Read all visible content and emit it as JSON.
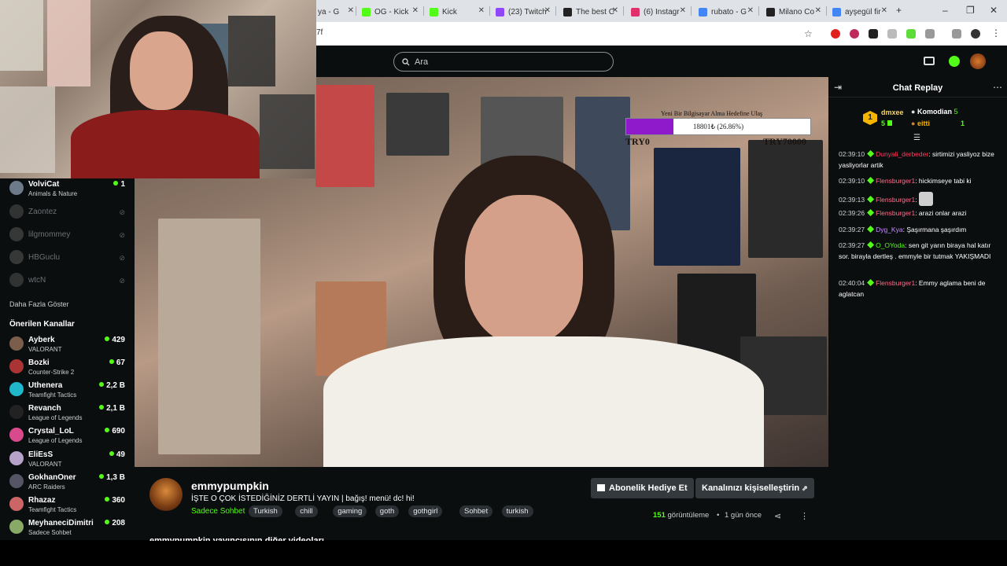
{
  "browser": {
    "tabs": [
      {
        "label": "ya - G",
        "color": "#4285f4"
      },
      {
        "label": "OG - Kick",
        "color": "#53fc18"
      },
      {
        "label": "Kick",
        "color": "#53fc18"
      },
      {
        "label": "(23) Twitch",
        "color": "#9146ff"
      },
      {
        "label": "The best C",
        "color": "#222222"
      },
      {
        "label": "(6) Instagr",
        "color": "#e1306c"
      },
      {
        "label": "rubato - G",
        "color": "#4285f4"
      },
      {
        "label": "Milano Co",
        "color": "#222222"
      },
      {
        "label": "ayşegül fir",
        "color": "#4285f4"
      }
    ],
    "address_fragment": "7f",
    "new_tab": "+"
  },
  "header": {
    "search_placeholder": "Ara"
  },
  "sidebar": {
    "followed": [
      {
        "name": "VolviCat",
        "category": "Animals & Nature",
        "viewers": "1",
        "live": true,
        "color": "#6c7a89"
      },
      {
        "name": "Zaontez",
        "live": false,
        "color": "#777"
      },
      {
        "name": "lilgmommey",
        "live": false,
        "color": "#888"
      },
      {
        "name": "HBGuclu",
        "live": false,
        "color": "#888"
      },
      {
        "name": "wtcN",
        "live": false,
        "color": "#777"
      }
    ],
    "show_more": "Daha Fazla Göster",
    "recommended_title": "Önerilen Kanallar",
    "recommended": [
      {
        "name": "Ayberk",
        "category": "VALORANT",
        "viewers": "429",
        "color": "#7a5d4a"
      },
      {
        "name": "Bozki",
        "category": "Counter-Strike 2",
        "viewers": "67",
        "color": "#a33"
      },
      {
        "name": "Uthenera",
        "category": "Teamfight Tactics",
        "viewers": "2,2 B",
        "color": "#1fb7c9"
      },
      {
        "name": "Revanch",
        "category": "League of Legends",
        "viewers": "2,1 B",
        "color": "#222"
      },
      {
        "name": "Crystal_LoL",
        "category": "League of Legends",
        "viewers": "690",
        "color": "#d94a8c"
      },
      {
        "name": "EliEsS",
        "category": "VALORANT",
        "viewers": "49",
        "color": "#b7a3c9"
      },
      {
        "name": "GokhanOner",
        "category": "ARC Raiders",
        "viewers": "1,3 B",
        "color": "#556"
      },
      {
        "name": "Rhazaz",
        "category": "Teamfight Tactics",
        "viewers": "360",
        "color": "#c66"
      },
      {
        "name": "MeyhaneciDimitri",
        "category": "Sadece Sohbet",
        "viewers": "208",
        "color": "#8a6"
      }
    ]
  },
  "video": {
    "goal_title": "Yeni Bir Bilgisayar Alma Hedefine Ulaş",
    "goal_text": "18801₺ (26.86%)",
    "goal_progress": 0.2686,
    "goal_min": "TRY0",
    "goal_max": "TRY70000"
  },
  "chat": {
    "title": "Chat Replay",
    "gifters": {
      "rank": "1",
      "first": {
        "name": "dmxee",
        "count": "5"
      },
      "second": {
        "name": "Komodian",
        "count": "5"
      },
      "third": {
        "name": "eitti",
        "count": "1"
      }
    },
    "messages": [
      {
        "time": "02:39:10",
        "user": "Dunyali_derbeder",
        "color": "#ff3b5c",
        "text": "sirtimizi yasliyoz bize yasliyorlar artik"
      },
      {
        "time": "02:39:10",
        "user": "Flensburger1",
        "color": "#ff6b8b",
        "text": "hickimseye tabi ki"
      },
      {
        "time": "02:39:13",
        "user": "Flensburger1",
        "color": "#ff6b8b",
        "text": ""
      },
      {
        "time": "02:39:26",
        "user": "Flensburger1",
        "color": "#ff6b8b",
        "text": "arazi onlar arazi"
      },
      {
        "time": "02:39:27",
        "user": "Dyg_Kya",
        "color": "#c58cff",
        "text": "Şaşırmana şaşırdım"
      },
      {
        "time": "02:39:27",
        "user": "O_OYoda",
        "color": "#53fc18",
        "text": "sen git yarın biraya hal katır sor. birayla dertleş . emmyle bir tutmak YAKIŞMADI"
      },
      {
        "time": "02:40:04",
        "user": "Flensburger1",
        "color": "#ff6b8b",
        "text": "Emmy aglama beni de aglatcan"
      }
    ]
  },
  "info": {
    "username": "emmypumpkin",
    "title": "İŞTE O ÇOK İSTEDİĞİNİZ DERTLİ YAYIN | bağış! menü! dc! hi!",
    "category": "Sadece Sohbet",
    "tags": [
      "Turkish",
      "chill",
      "gaming",
      "goth",
      "gothgirl",
      "Sohbet",
      "turkish"
    ],
    "gift_sub_btn": "Abonelik Hediye Et",
    "customize_btn": "Kanalınızı kişiselleştirin",
    "views_count": "151",
    "views_label": "görüntüleme",
    "time_ago": "1 gün önce",
    "more_videos": "emmypumpkin yayıncısının diğer videoları"
  },
  "colors": {
    "accent": "#53fc18",
    "bg": "#0b0e0f"
  }
}
